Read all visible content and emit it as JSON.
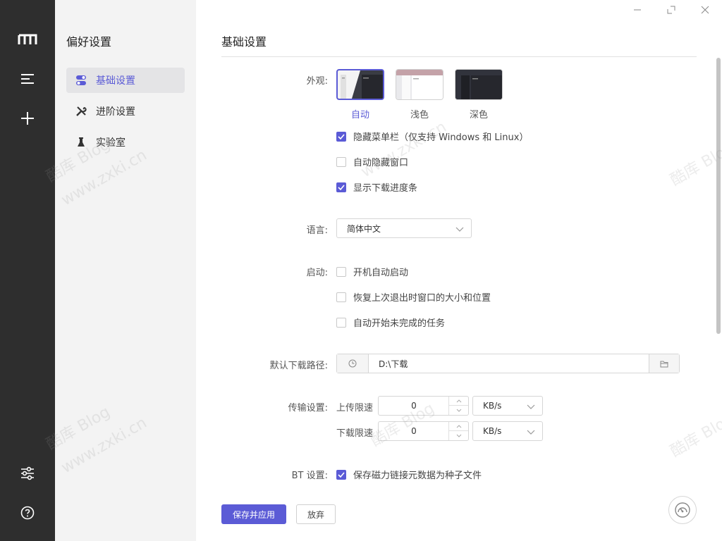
{
  "window": {
    "minimize_icon": "minimize-icon",
    "maximize_icon": "maximize-icon",
    "close_icon": "close-icon"
  },
  "rail": {
    "logo_icon": "logo-m-icon",
    "items": [
      {
        "icon": "menu-lines-icon"
      },
      {
        "icon": "plus-icon"
      },
      {
        "icon": "sliders-icon"
      },
      {
        "icon": "help-icon"
      }
    ]
  },
  "sidebar": {
    "title": "偏好设置",
    "items": [
      {
        "label": "基础设置",
        "icon": "toggle-icon",
        "active": true
      },
      {
        "label": "进阶设置",
        "icon": "tools-icon",
        "active": false
      },
      {
        "label": "实验室",
        "icon": "flask-icon",
        "active": false
      }
    ]
  },
  "main": {
    "title": "基础设置",
    "appearance": {
      "label": "外观:",
      "themes": [
        {
          "caption": "自动",
          "selected": true
        },
        {
          "caption": "浅色",
          "selected": false
        },
        {
          "caption": "深色",
          "selected": false
        }
      ],
      "options": [
        {
          "text": "隐藏菜单栏（仅支持 Windows 和 Linux）",
          "checked": true
        },
        {
          "text": "自动隐藏窗口",
          "checked": false
        },
        {
          "text": "显示下载进度条",
          "checked": true
        }
      ]
    },
    "language": {
      "label": "语言:",
      "value": "简体中文"
    },
    "startup": {
      "label": "启动:",
      "options": [
        {
          "text": "开机自动启动",
          "checked": false
        },
        {
          "text": "恢复上次退出时窗口的大小和位置",
          "checked": false
        },
        {
          "text": "自动开始未完成的任务",
          "checked": false
        }
      ]
    },
    "download_path": {
      "label": "默认下载路径:",
      "value": "D:\\下载"
    },
    "transfer": {
      "label": "传输设置:",
      "upload": {
        "label": "上传限速",
        "value": "0",
        "unit": "KB/s"
      },
      "download": {
        "label": "下载限速",
        "value": "0",
        "unit": "KB/s"
      }
    },
    "bt": {
      "label": "BT 设置:",
      "option": {
        "text": "保存磁力链接元数据为种子文件",
        "checked": true
      }
    },
    "buttons": {
      "save": "保存并应用",
      "discard": "放弃"
    }
  },
  "watermark": {
    "text1": "酷库 Blog",
    "text2": "www.zxki.cn"
  },
  "colors": {
    "accent": "#5b5bd6",
    "rail": "#2e2e2e",
    "sidebar": "#f3f3f3"
  }
}
